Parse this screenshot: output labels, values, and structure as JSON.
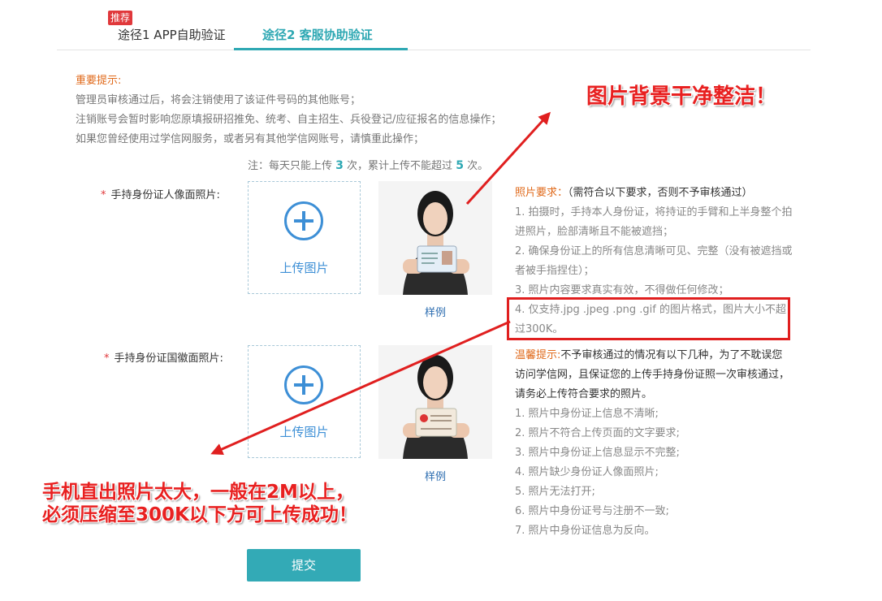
{
  "tabs": {
    "badge": "推荐",
    "tab1": "途径1 APP自助验证",
    "tab2": "途径2 客服协助验证"
  },
  "notice": {
    "title": "重要提示:",
    "lines": [
      "管理员审核通过后，将会注销使用了该证件号码的其他账号；",
      "注销账号会暂时影响您原填报研招推免、统考、自主招生、兵役登记/应征报名的信息操作；",
      "如果您曾经使用过学信网服务，或者另有其他学信网账号，请慎重此操作；"
    ],
    "limit_prefix": "注：每天只能上传",
    "limit_times": "3",
    "limit_mid": "次，累计上传不能超过",
    "limit_total": "5",
    "limit_suffix": "次。"
  },
  "form": {
    "required_mark": "*",
    "row1_label": "手持身份证人像面照片:",
    "row2_label": "手持身份证国徽面照片:",
    "upload_text": "上传图片",
    "sample_caption": "样例"
  },
  "requirements": {
    "title": "照片要求：",
    "subtitle": "（需符合以下要求，否则不予审核通过）",
    "items": [
      "1. 拍摄时，手持本人身份证，将持证的手臂和上半身整个拍进照片，脸部清晰且不能被遮挡；",
      "2. 确保身份证上的所有信息清晰可见、完整（没有被遮挡或者被手指捏住）；",
      "3. 照片内容要求真实有效，不得做任何修改；",
      "4. 仅支持.jpg .jpeg .png .gif 的图片格式，图片大小不超过300K。"
    ]
  },
  "tips": {
    "title": "温馨提示:",
    "intro": "不予审核通过的情况有以下几种，为了不耽误您访问学信网，且保证您的上传手持身份证照一次审核通过，请务必上传符合要求的照片。",
    "items": [
      "1. 照片中身份证上信息不清晰;",
      "2. 照片不符合上传页面的文字要求;",
      "3. 照片中身份证上信息显示不完整;",
      "4. 照片缺少身份证人像面照片;",
      "5. 照片无法打开;",
      "6. 照片中身份证号与注册不一致;",
      "7. 照片中身份证信息为反向。"
    ]
  },
  "submit_label": "提交",
  "annotations": {
    "callout1": "图片背景干净整洁！",
    "callout2_line1": "手机直出照片太大，一般在2M以上，",
    "callout2_line2": "必须压缩至300K以下方可上传成功！"
  },
  "colors": {
    "accent": "#2ea8b3",
    "warning": "#e06a1b",
    "annotation": "#e01f1f",
    "link": "#3d8fd6"
  }
}
